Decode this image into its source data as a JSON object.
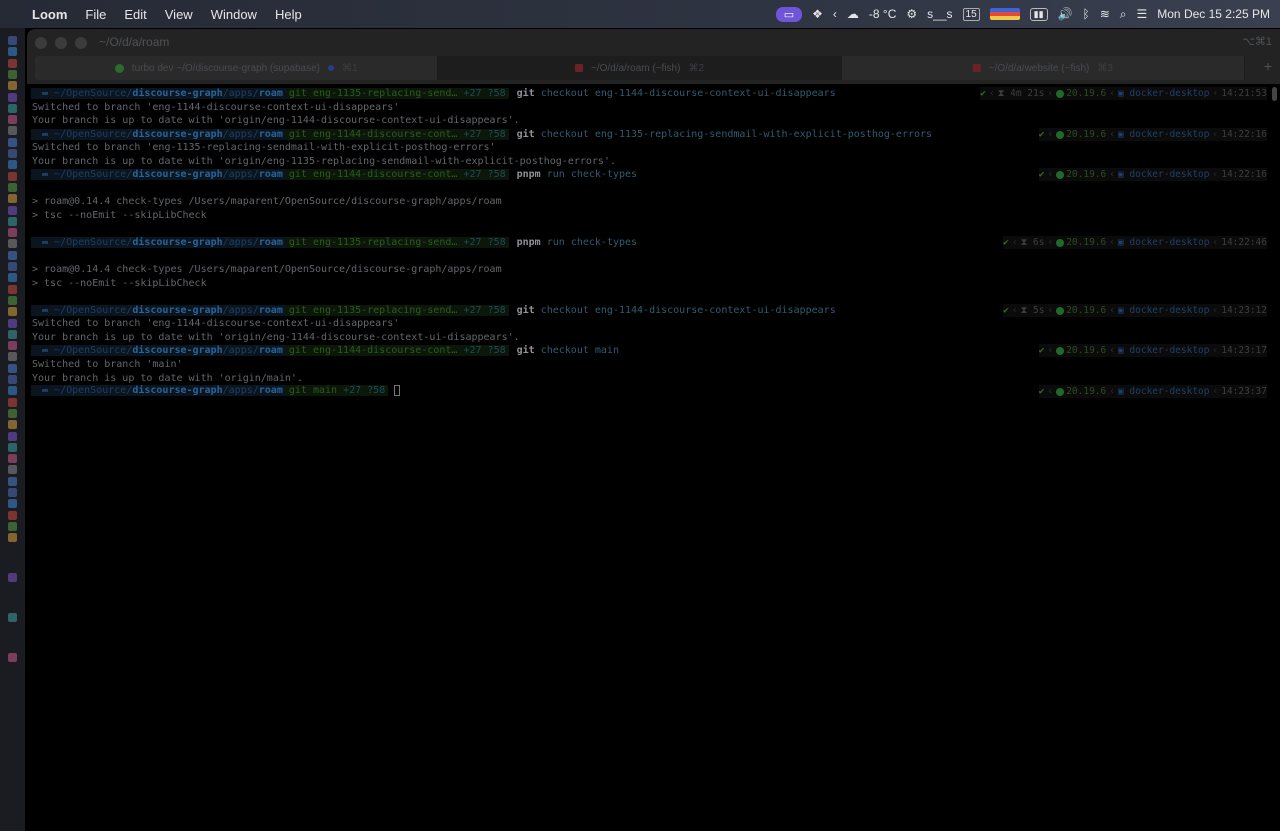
{
  "menubar": {
    "app": "Loom",
    "menus": [
      "File",
      "Edit",
      "View",
      "Window",
      "Help"
    ],
    "weather": "-8 °C",
    "user": "s__s",
    "calendar_day": "15",
    "datetime": "Mon Dec 15  2:25 PM"
  },
  "window": {
    "title": "~/O/d/a/roam",
    "shortcut": "⌥⌘1",
    "tabs": [
      {
        "label": "turbo dev ~/O/discourse-graph (supabase)",
        "kbd": "⌘1"
      },
      {
        "label": "~/O/d/a/roam (~fish)",
        "kbd": "⌘2"
      },
      {
        "label": "~/O/d/a/website (~fish)",
        "kbd": "⌘3"
      }
    ]
  },
  "prompt": {
    "path_prefix": "~/OpenSource/",
    "repo": "discourse-graph",
    "path_mid": "/apps/",
    "dir": "roam",
    "git_glyph": "git",
    "node_version": "20.19.6",
    "context": "docker-desktop"
  },
  "lines": [
    {
      "kind": "prompt",
      "branch": "eng-1135-replacing-send…",
      "counts": "+27 ?58",
      "cmd": "git",
      "args": "checkout eng-1144-discourse-context-ui-disappears",
      "duration": "4m 21s",
      "time": "14:21:53"
    },
    {
      "kind": "out",
      "text": "Switched to branch 'eng-1144-discourse-context-ui-disappears'"
    },
    {
      "kind": "out",
      "text": "Your branch is up to date with 'origin/eng-1144-discourse-context-ui-disappears'."
    },
    {
      "kind": "prompt",
      "branch": "eng-1144-discourse-cont…",
      "counts": "+27 ?58",
      "cmd": "git",
      "args": "checkout eng-1135-replacing-sendmail-with-explicit-posthog-errors",
      "duration": "",
      "time": "14:22:16"
    },
    {
      "kind": "out",
      "text": "Switched to branch 'eng-1135-replacing-sendmail-with-explicit-posthog-errors'"
    },
    {
      "kind": "out",
      "text": "Your branch is up to date with 'origin/eng-1135-replacing-sendmail-with-explicit-posthog-errors'."
    },
    {
      "kind": "prompt",
      "branch": "eng-1144-discourse-cont…",
      "counts": "+27 ?58",
      "cmd": "pnpm",
      "args": "run check-types",
      "duration": "",
      "time": "14:22:16"
    },
    {
      "kind": "blank"
    },
    {
      "kind": "out",
      "text": "> roam@0.14.4 check-types /Users/maparent/OpenSource/discourse-graph/apps/roam"
    },
    {
      "kind": "out",
      "text": "> tsc --noEmit --skipLibCheck"
    },
    {
      "kind": "blank"
    },
    {
      "kind": "prompt",
      "branch": "eng-1135-replacing-send…",
      "counts": "+27 ?58",
      "cmd": "pnpm",
      "args": "run check-types",
      "duration": "6s",
      "time": "14:22:46"
    },
    {
      "kind": "blank"
    },
    {
      "kind": "out",
      "text": "> roam@0.14.4 check-types /Users/maparent/OpenSource/discourse-graph/apps/roam"
    },
    {
      "kind": "out",
      "text": "> tsc --noEmit --skipLibCheck"
    },
    {
      "kind": "blank"
    },
    {
      "kind": "prompt",
      "branch": "eng-1135-replacing-send…",
      "counts": "+27 ?58",
      "cmd": "git",
      "args": "checkout eng-1144-discourse-context-ui-disappears",
      "duration": "5s",
      "time": "14:23:12"
    },
    {
      "kind": "out",
      "text": "Switched to branch 'eng-1144-discourse-context-ui-disappears'"
    },
    {
      "kind": "out",
      "text": "Your branch is up to date with 'origin/eng-1144-discourse-context-ui-disappears'."
    },
    {
      "kind": "prompt",
      "branch": "eng-1144-discourse-cont…",
      "counts": "+27 ?58",
      "cmd": "git",
      "args": "checkout main",
      "duration": "",
      "time": "14:23:17"
    },
    {
      "kind": "out",
      "text": "Switched to branch 'main'"
    },
    {
      "kind": "out",
      "text": "Your branch is up to date with 'origin/main'."
    },
    {
      "kind": "prompt",
      "branch": "main",
      "counts": "+27 ?58",
      "cmd": "",
      "args": "",
      "duration": "",
      "time": "14:23:37",
      "cursor": true
    }
  ]
}
